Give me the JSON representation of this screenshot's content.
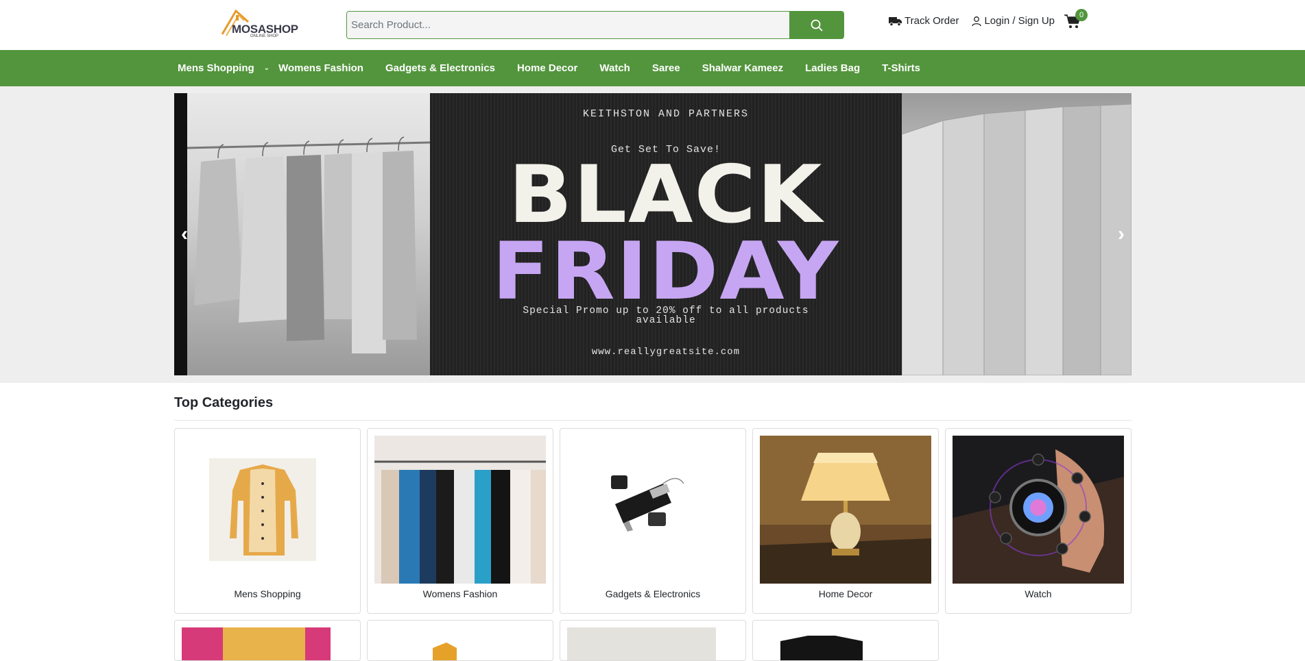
{
  "header": {
    "logo_text": "MOSASHOP",
    "logo_subtext": "ONLINE SHOP",
    "search_placeholder": "Search Product...",
    "track_order": "Track Order",
    "login": "Login / Sign Up",
    "cart_count": "0"
  },
  "nav": {
    "items": [
      "Mens Shopping",
      "Womens Fashion",
      "Gadgets & Electronics",
      "Home Decor",
      "Watch",
      "Saree",
      "Shalwar Kameez",
      "Ladies Bag",
      "T-Shirts"
    ]
  },
  "hero": {
    "brand": "KEITHSTON AND PARTNERS",
    "tagline": "Get Set To Save!",
    "headline_1": "BLACK",
    "headline_2": "FRIDAY",
    "special": "Special Promo up to 20% off to all products available",
    "url": "www.reallygreatsite.com",
    "prev_label": "‹",
    "next_label": "›"
  },
  "categories": {
    "title": "Top Categories",
    "items": [
      {
        "label": "Mens Shopping"
      },
      {
        "label": "Womens Fashion"
      },
      {
        "label": "Gadgets & Electronics"
      },
      {
        "label": "Home Decor"
      },
      {
        "label": "Watch"
      }
    ]
  },
  "colors": {
    "brand_green": "#53953d",
    "promo_purple": "#c6a6f2"
  }
}
